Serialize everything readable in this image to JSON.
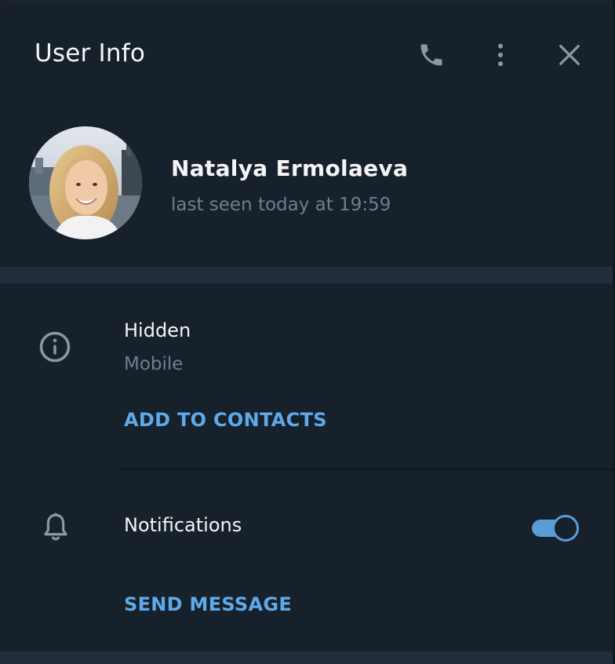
{
  "header": {
    "title": "User Info",
    "call_icon": "phone-icon",
    "more_icon": "more-vertical-icon",
    "close_icon": "close-icon"
  },
  "profile": {
    "name": "Natalya Ermolaeva",
    "status": "last seen today at 19:59"
  },
  "info": {
    "phone_value": "Hidden",
    "phone_label": "Mobile",
    "add_contact_label": "ADD TO CONTACTS",
    "icon": "info-icon"
  },
  "notifications": {
    "label": "Notifications",
    "enabled": true,
    "icon": "bell-icon"
  },
  "actions": {
    "send_message_label": "SEND MESSAGE"
  },
  "colors": {
    "panel_bg": "#17212b",
    "divider": "#232e3c",
    "accent": "#5fa9e9",
    "muted_text": "#6d7f90",
    "primary_text": "#f5f5f5"
  }
}
